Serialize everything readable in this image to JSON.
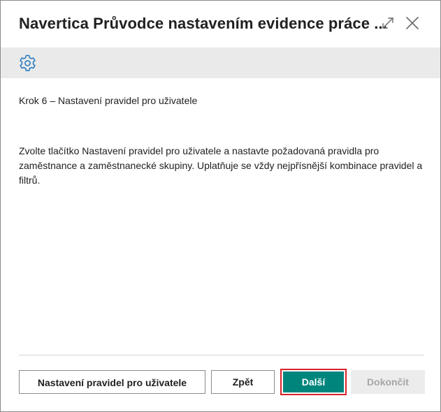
{
  "dialog": {
    "title": "Navertica Průvodce nastavením evidence práce ...",
    "expand_icon": "expand-icon",
    "close_icon": "close-icon"
  },
  "actionbar": {
    "settings_icon": "gear-icon"
  },
  "content": {
    "step_title": "Krok 6 – Nastavení pravidel pro uživatele",
    "description": "Zvolte tlačítko Nastavení pravidel pro uživatele a nastavte požadovaná pravidla pro zaměstnance a zaměstnanecké skupiny. Uplatňuje se vždy nejpřísnější kombinace pravidel a filtrů."
  },
  "footer": {
    "rules_button": "Nastavení pravidel pro uživatele",
    "back_button": "Zpět",
    "next_button": "Další",
    "finish_button": "Dokončit"
  },
  "colors": {
    "primary": "#00857d",
    "highlight_border": "#d9222a",
    "actionbar_bg": "#eaeaea",
    "disabled_bg": "#ececec",
    "disabled_text": "#a6a6a6",
    "gear": "#2b7bbf"
  }
}
